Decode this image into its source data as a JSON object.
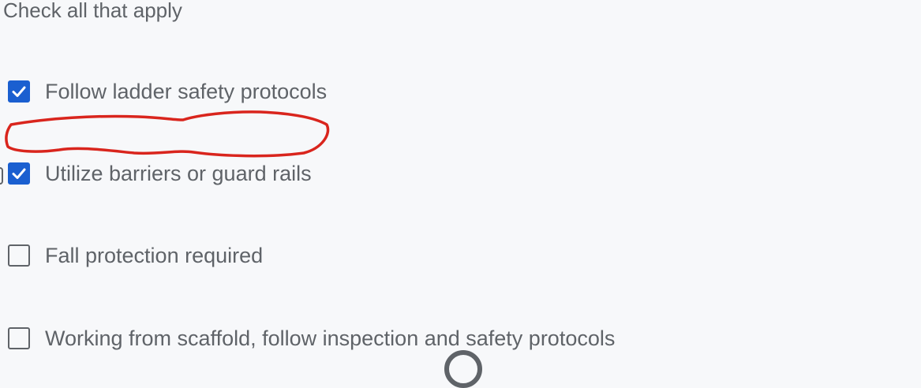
{
  "instruction": "Check all that apply",
  "options": [
    {
      "label": "Follow ladder safety protocols",
      "checked": true
    },
    {
      "label": "Utilize barriers or guard rails",
      "checked": true
    },
    {
      "label": "Fall protection required",
      "checked": false
    },
    {
      "label": "Working from scaffold, follow inspection and safety protocols",
      "checked": false
    }
  ],
  "colors": {
    "background": "#f7f8fa",
    "text": "#5f6368",
    "checkbox_checked": "#1a5fd0",
    "checkmark": "#ffffff",
    "annotation": "#d9251d"
  }
}
